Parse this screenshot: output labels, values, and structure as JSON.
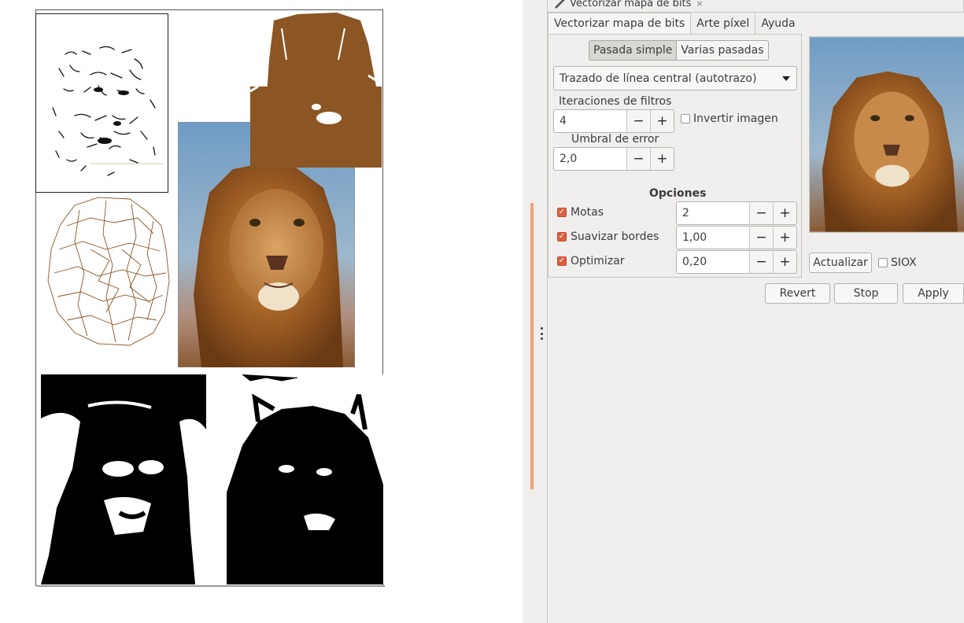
{
  "dock": {
    "title": "Vectorizar mapa de bits",
    "tabs": [
      "Vectorizar mapa de bits",
      "Arte píxel",
      "Ayuda"
    ],
    "mode_toggle": [
      "Pasada simple",
      "Varias pasadas"
    ],
    "trace_mode": "Trazado de línea central (autotrazo)",
    "filter_iterations": {
      "label": "Iteraciones de filtros",
      "value": "4"
    },
    "invert_image": {
      "label": "Invertir imagen",
      "checked": false
    },
    "error_threshold": {
      "label": "Umbral de error",
      "value": "2,0"
    },
    "options_heading": "Opciones",
    "options": {
      "speckles": {
        "label": "Motas",
        "checked": true,
        "value": "2"
      },
      "smooth_corners": {
        "label": "Suavizar bordes",
        "checked": true,
        "value": "1,00"
      },
      "optimize": {
        "label": "Optimizar",
        "checked": true,
        "value": "0,20"
      }
    },
    "update_button": "Actualizar",
    "siox": {
      "label": "SIOX",
      "checked": false
    },
    "actions": {
      "revert": "Revert",
      "stop": "Stop",
      "apply": "Apply"
    }
  },
  "icons": {
    "dock_icon": "brush-icon",
    "close": "close-icon",
    "minus": "minus-icon",
    "plus": "plus-icon",
    "dropdown": "chevron-down-icon"
  },
  "colors": {
    "accent_check": "#dd5f3f",
    "drag_stripe": "#f0a27a",
    "lion_brown": "#8b5524",
    "sky_blue": "#6f9cc4"
  }
}
